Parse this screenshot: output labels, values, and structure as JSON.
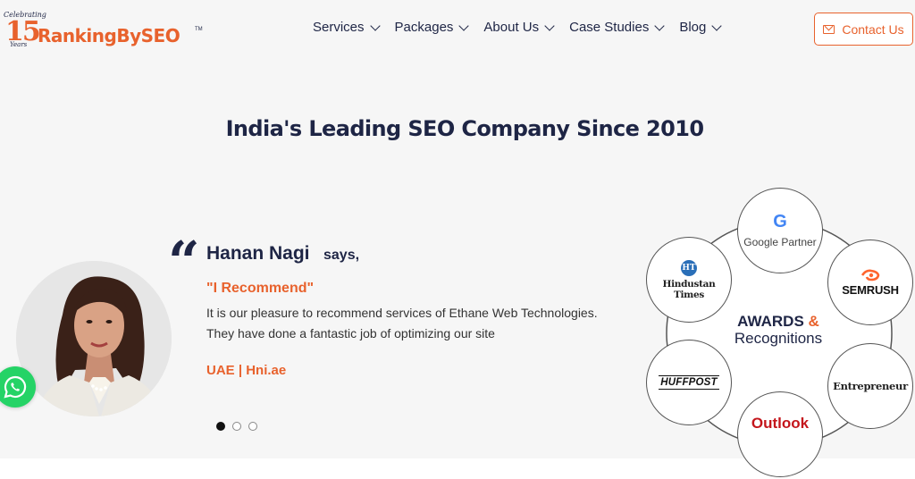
{
  "header": {
    "logo": {
      "celebrating": "Celebrating",
      "number": "15",
      "years": "Years",
      "brand": "RankingBySEO",
      "tm": "TM"
    },
    "nav": [
      {
        "label": "Services"
      },
      {
        "label": "Packages"
      },
      {
        "label": "About Us"
      },
      {
        "label": "Case Studies"
      },
      {
        "label": "Blog"
      }
    ],
    "contact_label": "Contact Us"
  },
  "hero": {
    "headline": "India's Leading SEO Company Since 2010"
  },
  "testimonial": {
    "name": "Hanan Nagi",
    "says": "says,",
    "recommend": "\"I Recommend\"",
    "body": "It is our pleasure to recommend services of Ethane Web Technologies. They have done a fantastic job of optimizing our site",
    "origin": "UAE | Hni.ae",
    "active_slide": 1,
    "slide_count": 3
  },
  "awards": {
    "title": "AWARDS",
    "amp": "&",
    "subtitle": "Recognitions",
    "badges": {
      "google": {
        "letter": "G",
        "label": "Google Partner"
      },
      "hindustan": {
        "logo": "HT",
        "label": "Hindustan Times"
      },
      "semrush": {
        "label": "SEMRUSH"
      },
      "huffpost": {
        "label": "HUFFPOST"
      },
      "entrepreneur": {
        "label": "Entrepreneur"
      },
      "outlook": {
        "label": "Outlook"
      }
    }
  },
  "colors": {
    "accent": "#e8622d",
    "navy": "#1e2545",
    "whatsapp": "#25d366"
  }
}
